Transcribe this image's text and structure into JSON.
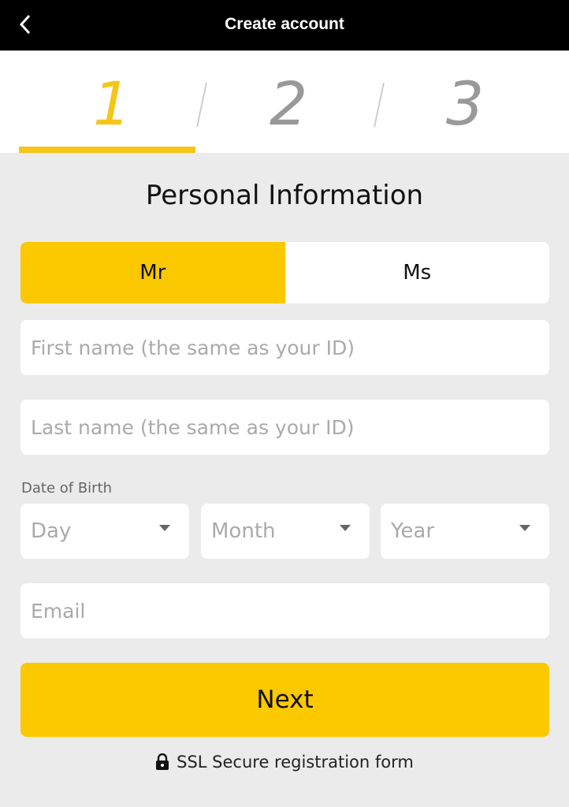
{
  "header": {
    "title": "Create account",
    "back_icon": "chevron-left-icon"
  },
  "steps": {
    "items": [
      {
        "label": "1",
        "active": true
      },
      {
        "label": "2",
        "active": false
      },
      {
        "label": "3",
        "active": false
      }
    ],
    "accent_color": "#f5c518"
  },
  "form": {
    "heading": "Personal Information",
    "gender_options": [
      {
        "label": "Mr",
        "selected": true
      },
      {
        "label": "Ms",
        "selected": false
      }
    ],
    "first_name": {
      "placeholder": "First name (the same as your ID)",
      "value": ""
    },
    "last_name": {
      "placeholder": "Last name (the same as your ID)",
      "value": ""
    },
    "dob": {
      "label": "Date of Birth",
      "day": "Day",
      "month": "Month",
      "year": "Year"
    },
    "email": {
      "placeholder": "Email",
      "value": ""
    },
    "next_label": "Next",
    "ssl_note": "SSL Secure registration form",
    "ssl_icon": "lock-icon"
  }
}
